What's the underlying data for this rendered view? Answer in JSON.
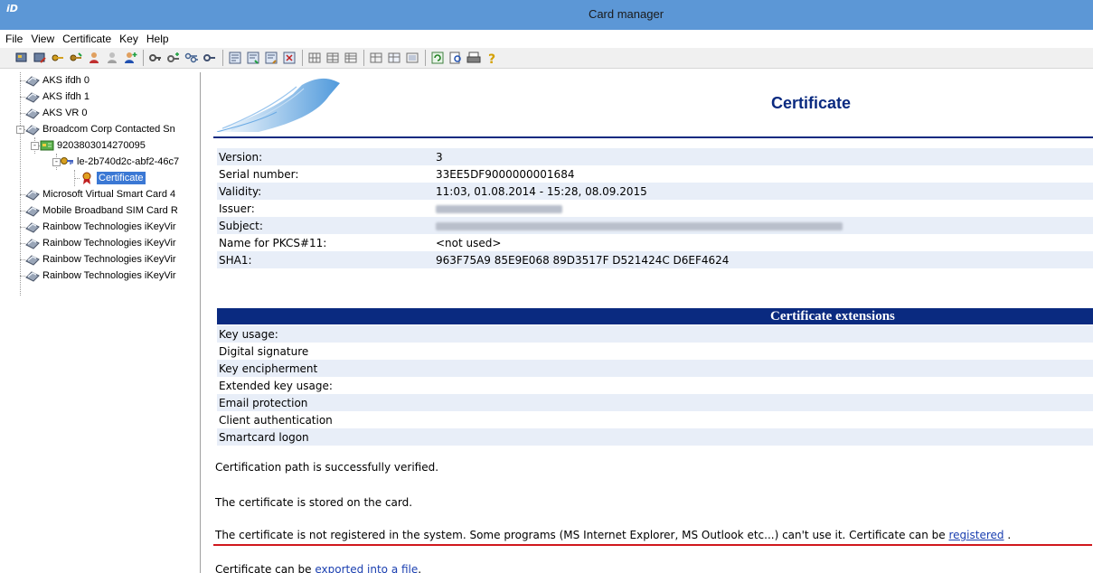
{
  "window": {
    "title": "Card manager",
    "app_icon_text": "iD"
  },
  "menu": [
    "File",
    "View",
    "Certificate",
    "Key",
    "Help"
  ],
  "toolbar": {
    "groups": [
      [
        "card-read-icon",
        "card-write-icon",
        "key-import-icon",
        "key-export-icon",
        "user-icon",
        "user-disabled-icon",
        "user-add-icon"
      ],
      [
        "key-icon",
        "key-add-icon",
        "key-pair-icon",
        "key-delete-icon"
      ],
      [
        "cert-view-icon",
        "cert-import-icon",
        "cert-export-icon",
        "cert-delete-icon"
      ],
      [
        "grid-icon",
        "grid-alt-icon",
        "grid-table-icon"
      ],
      [
        "table-icon",
        "table-add-icon",
        "table-view-icon"
      ],
      [
        "refresh-icon",
        "find-icon",
        "print-icon",
        "help-icon"
      ]
    ]
  },
  "tree": {
    "items": [
      {
        "label": "AKS ifdh 0",
        "icon": "card-reader-icon",
        "level": 0
      },
      {
        "label": "AKS ifdh 1",
        "icon": "card-reader-icon",
        "level": 0
      },
      {
        "label": "AKS VR 0",
        "icon": "card-reader-icon",
        "level": 0
      },
      {
        "label": "Broadcom Corp Contacted Sn",
        "icon": "card-reader-icon",
        "level": 0,
        "expanded": true
      },
      {
        "label": "9203803014270095",
        "icon": "smart-card-icon",
        "level": 1,
        "expanded": true
      },
      {
        "label": "le-2b740d2c-abf2-46c7",
        "icon": "key-pair-icon",
        "level": 2,
        "expanded": true
      },
      {
        "label": "Certificate",
        "icon": "certificate-icon",
        "level": 3,
        "selected": true
      },
      {
        "label": "Microsoft Virtual Smart Card 4",
        "icon": "card-reader-icon",
        "level": 0
      },
      {
        "label": "Mobile Broadband SIM Card R",
        "icon": "card-reader-icon",
        "level": 0
      },
      {
        "label": "Rainbow Technologies iKeyVir",
        "icon": "card-reader-icon",
        "level": 0
      },
      {
        "label": "Rainbow Technologies iKeyVir",
        "icon": "card-reader-icon",
        "level": 0
      },
      {
        "label": "Rainbow Technologies iKeyVir",
        "icon": "card-reader-icon",
        "level": 0
      },
      {
        "label": "Rainbow Technologies iKeyVir",
        "icon": "card-reader-icon",
        "level": 0
      }
    ]
  },
  "certificate": {
    "heading": "Certificate",
    "properties": [
      {
        "key": "Version:",
        "value": "3"
      },
      {
        "key": "Serial number:",
        "value": "33EE5DF9000000001684"
      },
      {
        "key": "Validity:",
        "value": "11:03, 01.08.2014 - 15:28, 08.09.2015"
      },
      {
        "key": "Issuer:",
        "value": "",
        "redacted": true
      },
      {
        "key": "Subject:",
        "value": "",
        "redacted": true
      },
      {
        "key": "Name for PKCS#11:",
        "value": "<not used>"
      },
      {
        "key": "SHA1:",
        "value": "963F75A9 85E9E068 89D3517F D521424C D6EF4624"
      }
    ],
    "extensions_heading": "Certificate extensions",
    "extensions": [
      "Key usage:",
      "Digital signature",
      "Key encipherment",
      "Extended key usage:",
      "Email protection",
      "Client authentication",
      "Smartcard logon"
    ],
    "messages": {
      "verified": "Certification path is successfully verified.",
      "stored": "The certificate is stored on the card.",
      "not_registered_prefix": "The certificate is not registered in the system. Some programs (MS Internet Explorer, MS Outlook etc...) can't use it. Certificate can be ",
      "register_link": "registered",
      "not_registered_suffix": " .",
      "export_prefix": "Certificate can be ",
      "export_link": "exported into a file",
      "export_suffix": "."
    }
  },
  "colors": {
    "titlebar": "#5c97d6",
    "accent": "#0a2a80",
    "selection": "#3b78d4",
    "underline": "#d0181d",
    "link": "#1a3fb0"
  }
}
